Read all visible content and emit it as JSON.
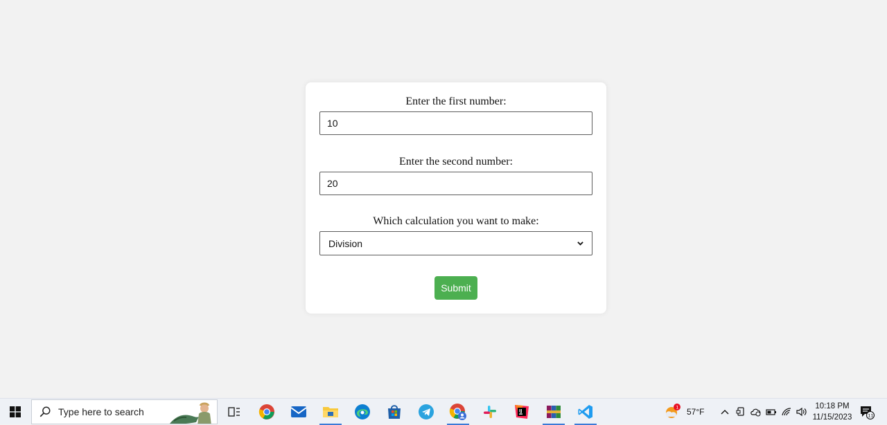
{
  "form": {
    "first_label": "Enter the first number:",
    "first_value": "10",
    "second_label": "Enter the second number:",
    "second_value": "20",
    "calc_label": "Which calculation you want to make:",
    "calc_selected": "Division",
    "submit_label": "Submit"
  },
  "colors": {
    "submit_bg": "#4caf50",
    "page_bg": "#f2f2f2",
    "card_bg": "#ffffff"
  },
  "taskbar": {
    "search_placeholder": "Type here to search",
    "apps": [
      "task-view-icon",
      "chrome-icon",
      "mail-icon",
      "file-explorer-icon",
      "edge-icon",
      "microsoft-store-icon",
      "telegram-icon",
      "chrome-profile-icon",
      "slack-icon",
      "jetbrains-icon",
      "winrar-icon",
      "vscode-icon"
    ],
    "weather_temp": "57°F",
    "weather_badge": "1",
    "time": "10:18 PM",
    "date": "11/15/2023",
    "notification_count": "11"
  }
}
